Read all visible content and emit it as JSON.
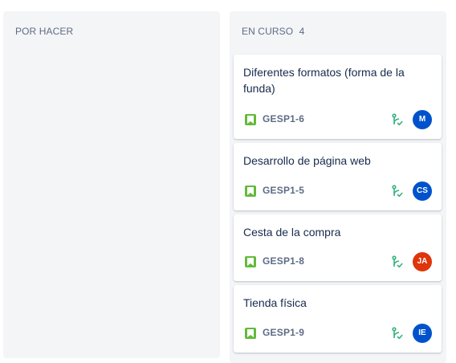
{
  "columns": [
    {
      "title": "POR HACER",
      "count": "",
      "cards": []
    },
    {
      "title": "EN CURSO",
      "count": "4",
      "cards": [
        {
          "title": "Diferentes formatos (forma de la funda)",
          "key": "GESP1-6",
          "avatar": "M",
          "avatar_color": "#0052cc"
        },
        {
          "title": "Desarrollo de página web",
          "key": "GESP1-5",
          "avatar": "CS",
          "avatar_color": "#0052cc"
        },
        {
          "title": "Cesta de la compra",
          "key": "GESP1-8",
          "avatar": "JA",
          "avatar_color": "#de350b"
        },
        {
          "title": "Tienda física",
          "key": "GESP1-9",
          "avatar": "IE",
          "avatar_color": "#0052cc"
        }
      ]
    }
  ],
  "icons": {
    "issue_type": "story-bookmark-icon",
    "development": "branch-icon"
  },
  "colors": {
    "column_background": "#f4f5f7",
    "story_green": "#63ba3c",
    "branch_green": "#36b37e"
  }
}
